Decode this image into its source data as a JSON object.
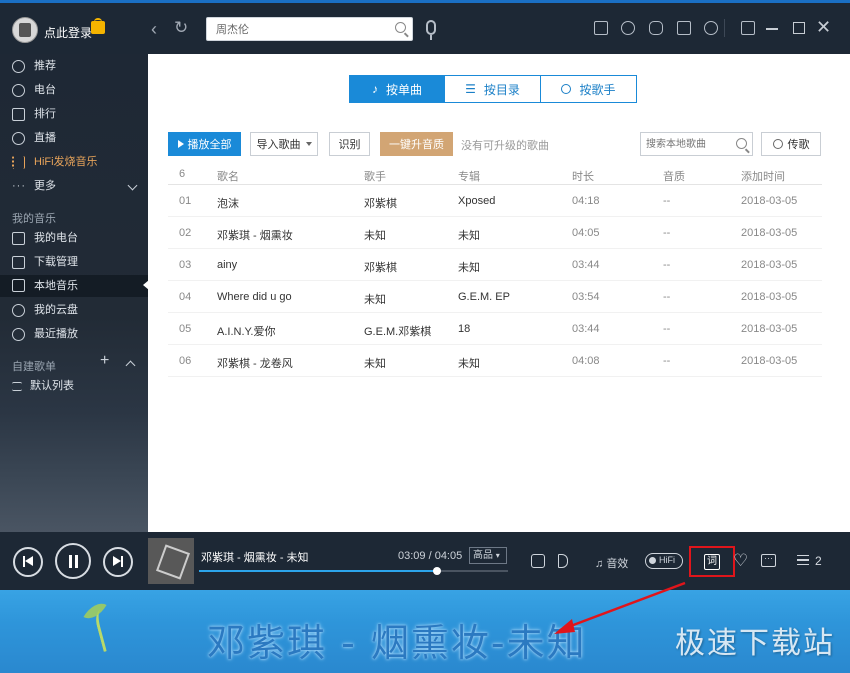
{
  "header": {
    "login_text": "点此登录",
    "search_value": "周杰伦"
  },
  "sidebar": {
    "online": [
      {
        "label": "推荐",
        "icon": "disc-icon"
      },
      {
        "label": "电台",
        "icon": "radio-icon"
      },
      {
        "label": "排行",
        "icon": "chart-icon"
      },
      {
        "label": "直播",
        "icon": "mic-icon"
      },
      {
        "label": "HiFi发烧音乐",
        "icon": "hifi-icon"
      },
      {
        "label": "更多",
        "icon": "more-icon"
      }
    ],
    "my_music_title": "我的音乐",
    "my_music": [
      {
        "label": "我的电台",
        "icon": "my-radio-icon"
      },
      {
        "label": "下载管理",
        "icon": "download-icon"
      },
      {
        "label": "本地音乐",
        "icon": "speaker-icon",
        "active": true
      },
      {
        "label": "我的云盘",
        "icon": "cloud-icon"
      },
      {
        "label": "最近播放",
        "icon": "clock-icon"
      }
    ],
    "playlist_title": "自建歌单",
    "playlists": [
      {
        "label": "默认列表",
        "icon": "list-icon"
      }
    ]
  },
  "tabs": [
    {
      "label": "按单曲",
      "active": true
    },
    {
      "label": "按目录",
      "active": false
    },
    {
      "label": "按歌手",
      "active": false
    }
  ],
  "toolbar": {
    "play_all": "播放全部",
    "import": "导入歌曲",
    "identify": "识别",
    "upgrade": "一键升音质",
    "no_upgrade": "没有可升级的歌曲",
    "search_placeholder": "搜索本地歌曲",
    "upload": "传歌"
  },
  "table": {
    "headers": {
      "index": "6",
      "name": "歌名",
      "artist": "歌手",
      "album": "专辑",
      "duration": "时长",
      "quality": "音质",
      "added": "添加时间"
    },
    "rows": [
      {
        "index": "01",
        "name": "泡沫",
        "artist": "邓紫棋",
        "album": "Xposed",
        "duration": "04:18",
        "quality": "--",
        "added": "2018-03-05"
      },
      {
        "index": "02",
        "name": "邓紫琪 - 烟熏妆",
        "artist": "未知",
        "album": "未知",
        "duration": "04:05",
        "quality": "--",
        "added": "2018-03-05"
      },
      {
        "index": "03",
        "name": "ainy",
        "artist": "邓紫棋",
        "album": "未知",
        "duration": "03:44",
        "quality": "--",
        "added": "2018-03-05"
      },
      {
        "index": "04",
        "name": "Where did u go",
        "artist": "未知",
        "album": "G.E.M. EP",
        "duration": "03:54",
        "quality": "--",
        "added": "2018-03-05"
      },
      {
        "index": "05",
        "name": "A.I.N.Y.爱你",
        "artist": "G.E.M.邓紫棋",
        "album": "18",
        "duration": "03:44",
        "quality": "--",
        "added": "2018-03-05"
      },
      {
        "index": "06",
        "name": "邓紫棋 - 龙卷风",
        "artist": "未知",
        "album": "未知",
        "duration": "04:08",
        "quality": "--",
        "added": "2018-03-05"
      }
    ]
  },
  "player": {
    "title": "邓紫琪 - 烟熏妆 - 未知",
    "time": "03:09 / 04:05",
    "quality": "高品",
    "progress_fraction": 0.77,
    "effect": "音效",
    "hifi": "HiFi",
    "lyric_button": "词",
    "playlist_count": "2"
  },
  "desktop_lyric": {
    "text": "邓紫琪 - 烟熏妆-未知",
    "watermark": "极速下载站"
  },
  "colors": {
    "accent": "#1a8ad8",
    "upgrade": "#d2a574",
    "highlight_box": "#e0151b",
    "sidebar_bg": "#1e2835"
  }
}
